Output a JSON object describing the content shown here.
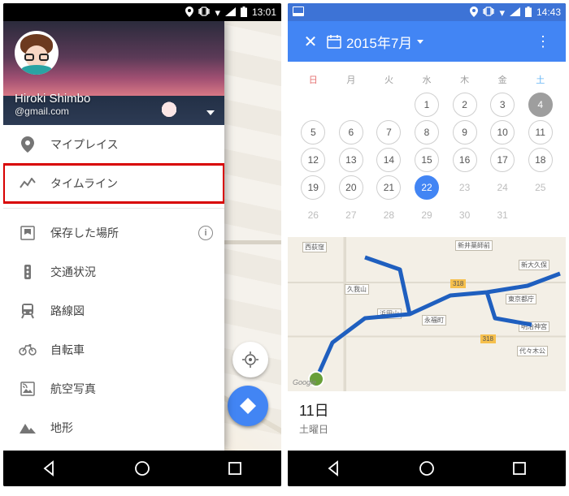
{
  "left": {
    "status": {
      "time": "13:01"
    },
    "account": {
      "name": "Hiroki Shimbo",
      "email": "@gmail.com"
    },
    "menu": {
      "my_places": "マイプレイス",
      "timeline": "タイムライン",
      "saved": "保存した場所",
      "traffic": "交通状況",
      "transit": "路線図",
      "bicycle": "自転車",
      "satellite": "航空写真",
      "terrain": "地形"
    }
  },
  "right": {
    "status": {
      "time": "14:43"
    },
    "header": {
      "title": "2015年7月"
    },
    "dow": {
      "sun": "日",
      "mon": "月",
      "tue": "火",
      "wed": "水",
      "thu": "木",
      "fri": "金",
      "sat": "土"
    },
    "calendar": {
      "weeks": [
        [
          "",
          "",
          "",
          "1",
          "2",
          "3",
          "4"
        ],
        [
          "5",
          "6",
          "7",
          "8",
          "9",
          "10",
          "11"
        ],
        [
          "12",
          "13",
          "14",
          "15",
          "16",
          "17",
          "18"
        ],
        [
          "19",
          "20",
          "21",
          "22",
          "23",
          "24",
          "25"
        ],
        [
          "26",
          "27",
          "28",
          "29",
          "30",
          "31",
          ""
        ]
      ],
      "selected": "22",
      "today": "4",
      "disabled_from": "23"
    },
    "map": {
      "labels": {
        "a": "西荻窪",
        "b": "久我山",
        "c": "浜田山",
        "d": "永福町",
        "e": "新井薬師前",
        "f": "新大久保",
        "g": "東京都庁",
        "h": "明治神宮",
        "i": "代々木公",
        "j": "318",
        "k": "318"
      },
      "attribution": "Google"
    },
    "day": {
      "title": "11日",
      "sub": "土曜日"
    }
  }
}
